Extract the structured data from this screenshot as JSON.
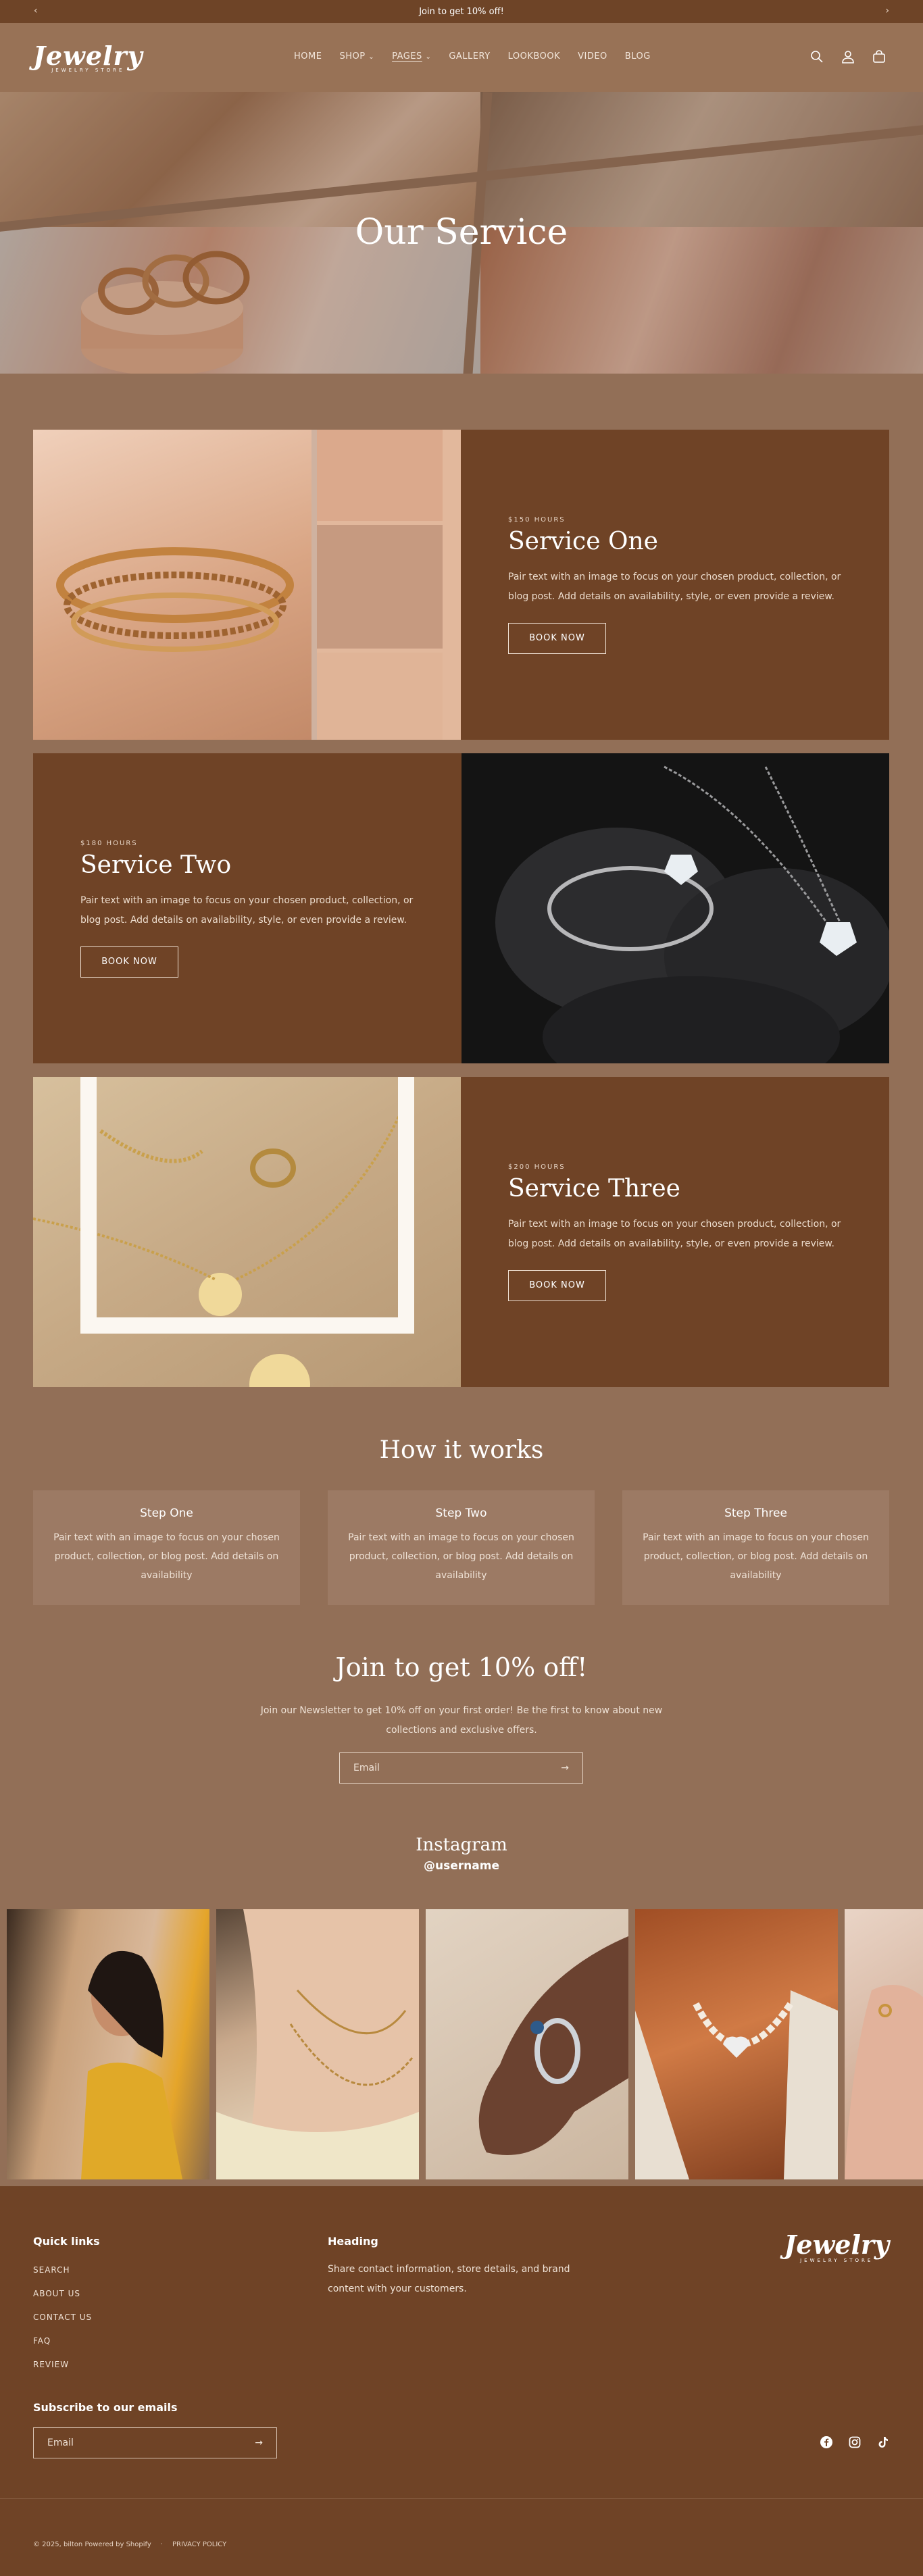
{
  "announcement": {
    "text": "Join to get 10% off!"
  },
  "brand": {
    "name": "Jewelry",
    "tagline": "JEWELRY STORE"
  },
  "nav": {
    "items": [
      "HOME",
      "SHOP",
      "PAGES",
      "GALLERY",
      "LOOKBOOK",
      "VIDEO",
      "BLOG"
    ],
    "active": "PAGES"
  },
  "hero": {
    "title": "Our Service"
  },
  "services": [
    {
      "price": "$150 HOURS",
      "title": "Service One",
      "text": "Pair text with an image to focus on your chosen product, collection, or blog post. Add details on availability, style, or even provide a review.",
      "button": "BOOK NOW"
    },
    {
      "price": "$180 HOURS",
      "title": "Service Two",
      "text": "Pair text with an image to focus on your chosen product, collection, or blog post. Add details on availability, style, or even provide a review.",
      "button": "BOOK NOW"
    },
    {
      "price": "$200 HOURS",
      "title": "Service Three",
      "text": "Pair text with an image to focus on your chosen product, collection, or blog post. Add details on availability, style, or even provide a review.",
      "button": "BOOK NOW"
    }
  ],
  "how": {
    "title": "How it works",
    "steps": [
      {
        "title": "Step One",
        "text": "Pair text with an image to focus on your chosen product, collection, or blog post. Add details on availability"
      },
      {
        "title": "Step Two",
        "text": "Pair text with an image to focus on your chosen product, collection, or blog post. Add details on availability"
      },
      {
        "title": "Step Three",
        "text": "Pair text with an image to focus on your chosen product, collection, or blog post. Add details on availability"
      }
    ]
  },
  "newsletter": {
    "title": "Join to get 10% off!",
    "text": "Join our Newsletter to get 10% off on your first order! Be the first to know about new collections and exclusive offers.",
    "placeholder": "Email"
  },
  "instagram": {
    "title": "Instagram",
    "username": "@username"
  },
  "footer": {
    "quick_links_title": "Quick links",
    "links": [
      "SEARCH",
      "ABOUT US",
      "CONTACT US",
      "FAQ",
      "REVIEW"
    ],
    "heading": "Heading",
    "heading_text": "Share contact information, store details, and brand content with your customers.",
    "subscribe_title": "Subscribe to our emails",
    "email_placeholder": "Email",
    "copyright": "© 2025, bilton Powered by Shopify",
    "policy": "PRIVACY POLICY"
  },
  "colors": {
    "page_bg": "#926f57",
    "dark_brown": "#6f4326",
    "announce_bg": "#6e4427"
  }
}
